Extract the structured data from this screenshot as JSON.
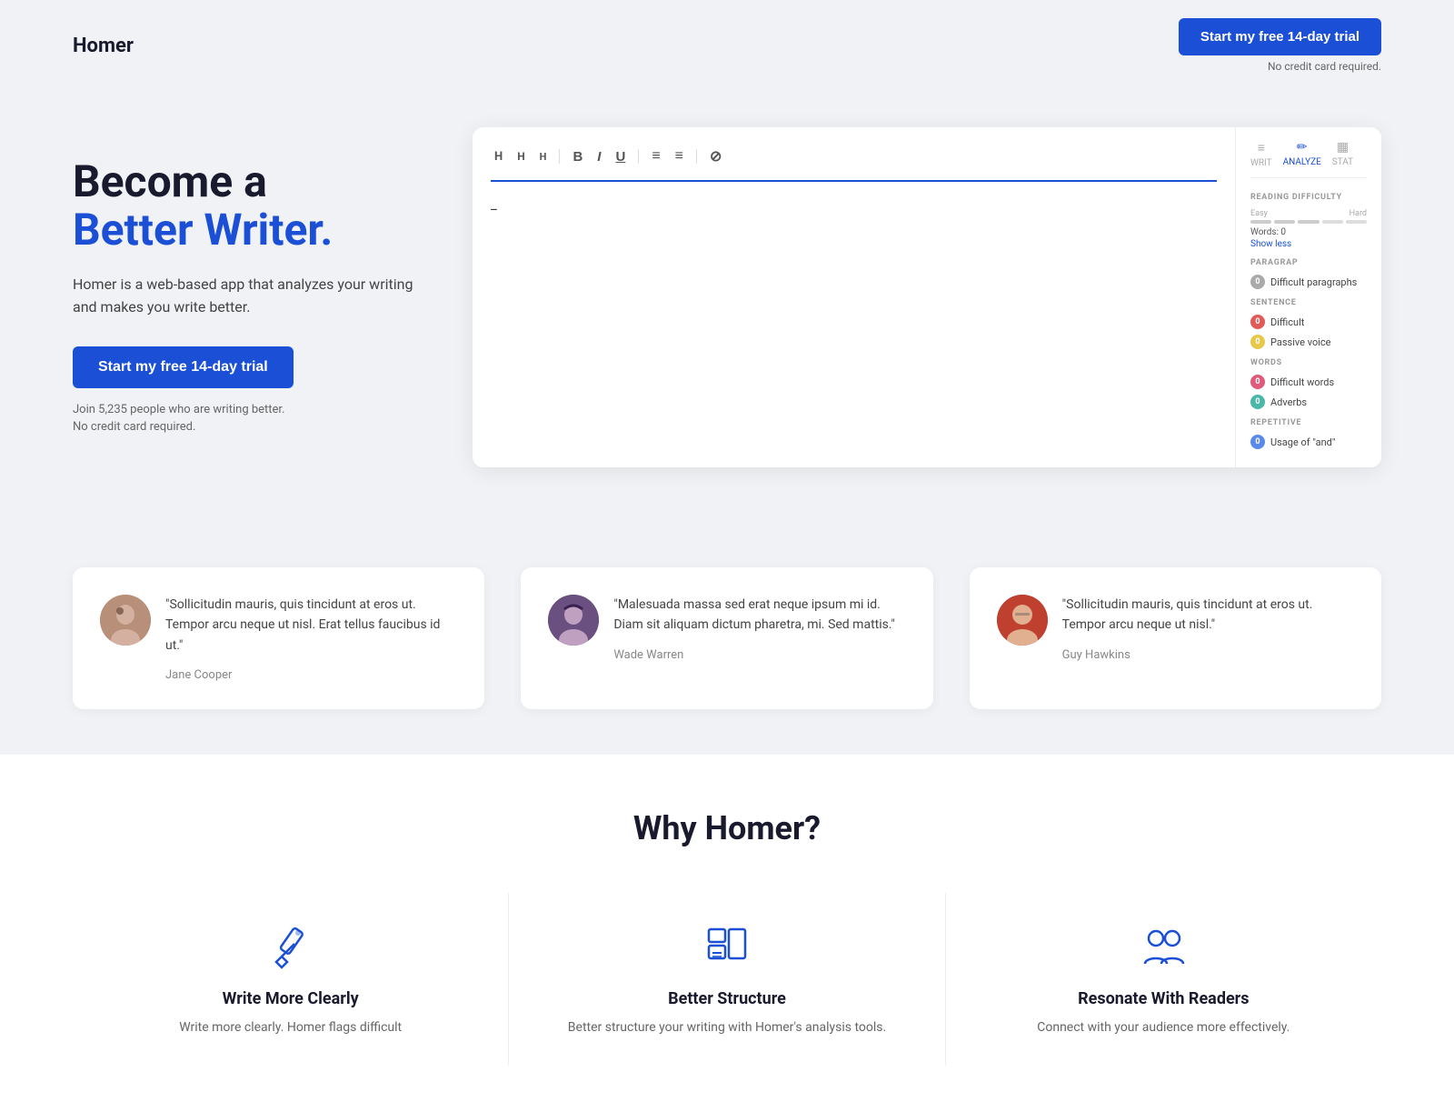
{
  "header": {
    "logo": "Homer",
    "cta_label": "Start my free 14-day trial",
    "no_cc": "No credit card required."
  },
  "hero": {
    "title_black": "Become a",
    "title_blue": "Better Writer.",
    "description": "Homer is a web-based app that analyzes your writing and makes you write better.",
    "cta_label": "Start my free 14-day trial",
    "sub_line1": "Join 5,235 people who are writing better.",
    "sub_line2": "No credit card required."
  },
  "editor": {
    "toolbar": {
      "h1": "H",
      "h2": "H",
      "h3": "H",
      "bold": "B",
      "italic": "I",
      "underline": "U",
      "list_ul": "≡",
      "list_ol": "≡",
      "clear": "⊘"
    },
    "cursor": "_",
    "tabs": [
      {
        "id": "write",
        "label": "WRIT",
        "icon": "≡"
      },
      {
        "id": "analyze",
        "label": "ANALYZE",
        "icon": "✏"
      },
      {
        "id": "stat",
        "label": "STAT",
        "icon": "▦"
      }
    ],
    "panel": {
      "reading_difficulty_title": "READING DIFFICULTY",
      "easy_label": "Easy",
      "hard_label": "Hard",
      "words_label": "Words: 0",
      "show_less": "Show less",
      "paragraph_title": "PARAGRAP",
      "sentence_title": "SENTENCE",
      "words_title": "WORDS",
      "repetitive_title": "REPETITIVE",
      "items": [
        {
          "count": "0",
          "label": "Difficult paragraphs",
          "color": "gray"
        },
        {
          "count": "0",
          "label": "Difficult",
          "color": "red"
        },
        {
          "count": "0",
          "label": "Passive voice",
          "color": "yellow"
        },
        {
          "count": "0",
          "label": "Difficult words",
          "color": "pink"
        },
        {
          "count": "0",
          "label": "Adverbs",
          "color": "teal"
        },
        {
          "count": "0",
          "label": "Usage of \"and\"",
          "color": "blue"
        }
      ]
    }
  },
  "testimonials": [
    {
      "text": "\"Sollicitudin mauris, quis tincidunt at eros ut. Tempor arcu neque ut nisl. Erat tellus faucibus id ut.\"",
      "name": "Jane Cooper"
    },
    {
      "text": "\"Malesuada massa sed erat neque ipsum mi id. Diam sit aliquam dictum pharetra, mi. Sed mattis.\"",
      "name": "Wade Warren"
    },
    {
      "text": "\"Sollicitudin mauris, quis tincidunt at eros ut. Tempor arcu neque ut nisl.\"",
      "name": "Guy Hawkins"
    }
  ],
  "why": {
    "title": "Why Homer?",
    "features": [
      {
        "name": "Write More Clearly",
        "description": "Write more clearly. Homer flags difficult"
      },
      {
        "name": "Better Structure",
        "description": "Better structure your writing with Homer's analysis tools."
      },
      {
        "name": "Resonate With Readers",
        "description": "Connect with your audience more effectively."
      }
    ]
  }
}
